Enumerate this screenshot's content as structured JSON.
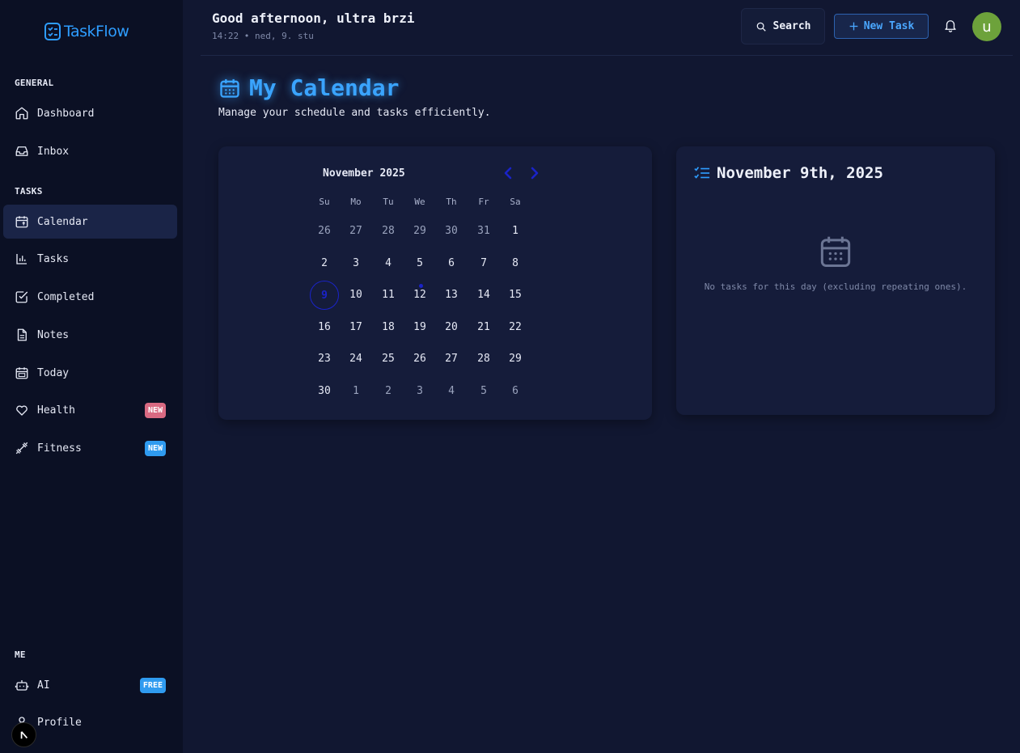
{
  "app": {
    "name": "TaskFlow"
  },
  "sidebar": {
    "sections": {
      "general": "GENERAL",
      "tasks": "TASKS",
      "me": "ME"
    },
    "items": {
      "dashboard": "Dashboard",
      "inbox": "Inbox",
      "calendar": "Calendar",
      "tasks": "Tasks",
      "completed": "Completed",
      "notes": "Notes",
      "today": "Today",
      "health": "Health",
      "fitness": "Fitness",
      "ai": "AI",
      "profile": "Profile"
    },
    "badges": {
      "health": "NEW",
      "fitness": "NEW",
      "ai": "FREE"
    },
    "active": "calendar"
  },
  "header": {
    "greeting": "Good afternoon, ultra brzi",
    "datetime": "14:22 • ned, 9. stu",
    "search_label": "Search",
    "new_task_label": "New Task",
    "avatar_initial": "u"
  },
  "page": {
    "title": "My Calendar",
    "subtitle": "Manage your schedule and tasks efficiently."
  },
  "calendar": {
    "month_label": "November 2025",
    "weekdays": [
      "Su",
      "Mo",
      "Tu",
      "We",
      "Th",
      "Fr",
      "Sa"
    ],
    "weeks": [
      [
        "26",
        "27",
        "28",
        "29",
        "30",
        "31",
        "1"
      ],
      [
        "2",
        "3",
        "4",
        "5",
        "6",
        "7",
        "8"
      ],
      [
        "9",
        "10",
        "11",
        "12",
        "13",
        "14",
        "15"
      ],
      [
        "16",
        "17",
        "18",
        "19",
        "20",
        "21",
        "22"
      ],
      [
        "23",
        "24",
        "25",
        "26",
        "27",
        "28",
        "29"
      ],
      [
        "30",
        "1",
        "2",
        "3",
        "4",
        "5",
        "6"
      ]
    ],
    "selected_day": "9",
    "days_with_tasks": [
      "12"
    ]
  },
  "day_panel": {
    "title": "November 9th, 2025",
    "empty_text": "No tasks for this day (excluding repeating ones)."
  },
  "colors": {
    "accent": "#2e9dff",
    "selected": "#1a23c8",
    "avatar": "#6da23b",
    "badge_new_red": "#d96a82",
    "badge_blue": "#2f9bf0"
  }
}
